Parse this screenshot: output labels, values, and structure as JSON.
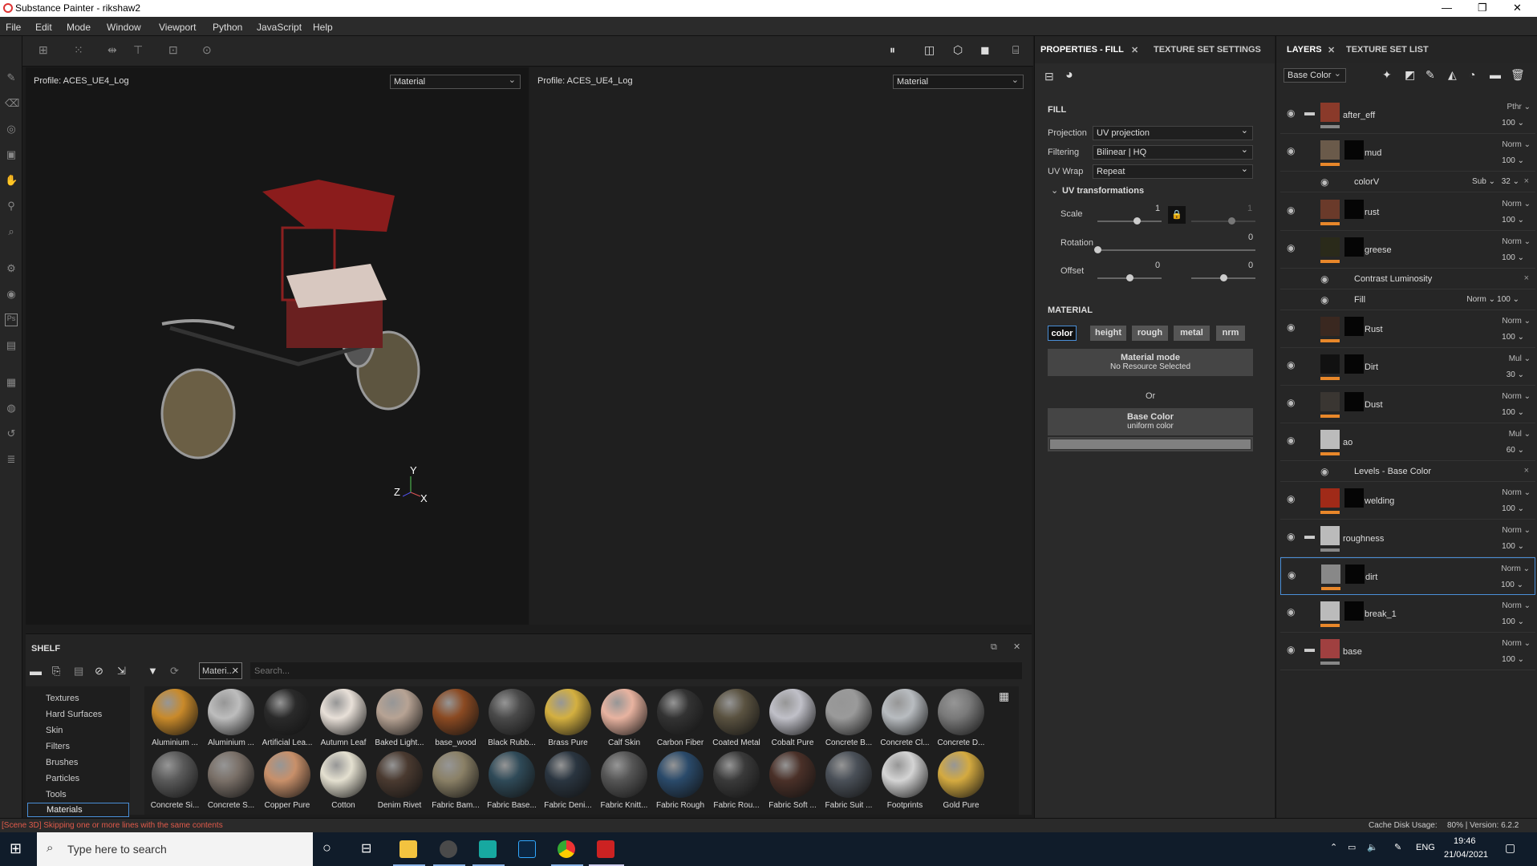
{
  "window": {
    "title": "Substance Painter - rikshaw2",
    "minimize": "—",
    "maximize": "❐",
    "close": "✕"
  },
  "menu": [
    "File",
    "Edit",
    "Mode",
    "Window",
    "Viewport",
    "Python",
    "JavaScript",
    "Help"
  ],
  "viewport": {
    "left_profile": "Profile: ACES_UE4_Log",
    "right_profile": "Profile: ACES_UE4_Log",
    "left_mode": "Material",
    "right_mode": "Material",
    "axis_y": "Y",
    "axis_z": "Z",
    "axis_x": "X"
  },
  "shelf": {
    "title": "SHELF",
    "filter_tag": "Materi...",
    "search_placeholder": "Search...",
    "categories": [
      "Textures",
      "Hard Surfaces",
      "Skin",
      "Filters",
      "Brushes",
      "Particles",
      "Tools",
      "Materials"
    ],
    "materials_row1": [
      "Aluminium ...",
      "Aluminium ...",
      "Artificial Lea...",
      "Autumn Leaf",
      "Baked Light...",
      "base_wood",
      "Black Rubb...",
      "Brass Pure",
      "Calf Skin",
      "Carbon Fiber",
      "Coated Metal",
      "Cobalt Pure",
      "Concrete B...",
      "Concrete Cl...",
      "Concrete D..."
    ],
    "materials_row2": [
      "Concrete Si...",
      "Concrete S...",
      "Copper Pure",
      "Cotton",
      "Denim Rivet",
      "Fabric Bam...",
      "Fabric Base...",
      "Fabric Deni...",
      "Fabric Knitt...",
      "Fabric Rough",
      "Fabric Rou...",
      "Fabric Soft ...",
      "Fabric Suit ...",
      "Footprints",
      "Gold Pure"
    ]
  },
  "properties": {
    "tab_active": "PROPERTIES - FILL",
    "tab_close": "✕",
    "tab2": "TEXTURE SET SETTINGS",
    "fill": "FILL",
    "projection_label": "Projection",
    "projection": "UV projection",
    "filtering_label": "Filtering",
    "filtering": "Bilinear | HQ",
    "uvwrap_label": "UV Wrap",
    "uvwrap": "Repeat",
    "uvt": "UV transformations",
    "scale_label": "Scale",
    "scale_val": "1",
    "scale_val2": "1",
    "rotation_label": "Rotation",
    "rotation_val": "0",
    "offset_label": "Offset",
    "offset_val1": "0",
    "offset_val2": "0",
    "material": "MATERIAL",
    "channels": [
      "color",
      "height",
      "rough",
      "metal",
      "nrm"
    ],
    "mode_title": "Material mode",
    "mode_sub": "No Resource Selected",
    "or": "Or",
    "base_title": "Base Color",
    "base_sub": "uniform color"
  },
  "layers": {
    "tab_active": "LAYERS",
    "tab_close": "✕",
    "tab2": "TEXTURE SET LIST",
    "channel": "Base Color",
    "rows": [
      {
        "name": "after_eff",
        "blend": "Pthr ⌄",
        "opacity": "100 ⌄"
      },
      {
        "name": "mud",
        "blend": "Norm ⌄",
        "opacity": "100 ⌄"
      },
      {
        "name": "rust",
        "blend": "Norm ⌄",
        "opacity": "100 ⌄"
      },
      {
        "name": "greese",
        "blend": "Norm ⌄",
        "opacity": "100 ⌄"
      },
      {
        "name": "Rust",
        "blend": "Norm ⌄",
        "opacity": "100 ⌄"
      },
      {
        "name": "Dirt",
        "blend": "Mul ⌄",
        "opacity": "30 ⌄"
      },
      {
        "name": "Dust",
        "blend": "Norm ⌄",
        "opacity": "100 ⌄"
      },
      {
        "name": "ao",
        "blend": "Mul ⌄",
        "opacity": "60 ⌄"
      },
      {
        "name": "welding",
        "blend": "Norm ⌄",
        "opacity": "100 ⌄"
      },
      {
        "name": "roughness",
        "blend": "Norm ⌄",
        "opacity": "100 ⌄"
      },
      {
        "name": "dirt",
        "blend": "Norm ⌄",
        "opacity": "100 ⌄"
      },
      {
        "name": "break_1",
        "blend": "Norm ⌄",
        "opacity": "100 ⌄"
      },
      {
        "name": "base",
        "blend": "Norm ⌄",
        "opacity": "100 ⌄"
      }
    ],
    "sub": {
      "colorV": "colorV",
      "colorV_blend": "Sub ⌄",
      "colorV_op": "32 ⌄",
      "contrast": "Contrast Luminosity",
      "fill": "Fill",
      "fill_blend": "Norm ⌄",
      "fill_op": "100 ⌄",
      "levels": "Levels - Base Color",
      "x": "×"
    }
  },
  "status": {
    "message": "[Scene 3D] Skipping one or more lines with the same contents",
    "cache": "Cache Disk Usage:",
    "cache_val": "80% | Version: 6.2.2"
  },
  "taskbar": {
    "search": "Type here to search",
    "lang": "ENG",
    "time": "19:46",
    "date": "21/04/2021"
  }
}
